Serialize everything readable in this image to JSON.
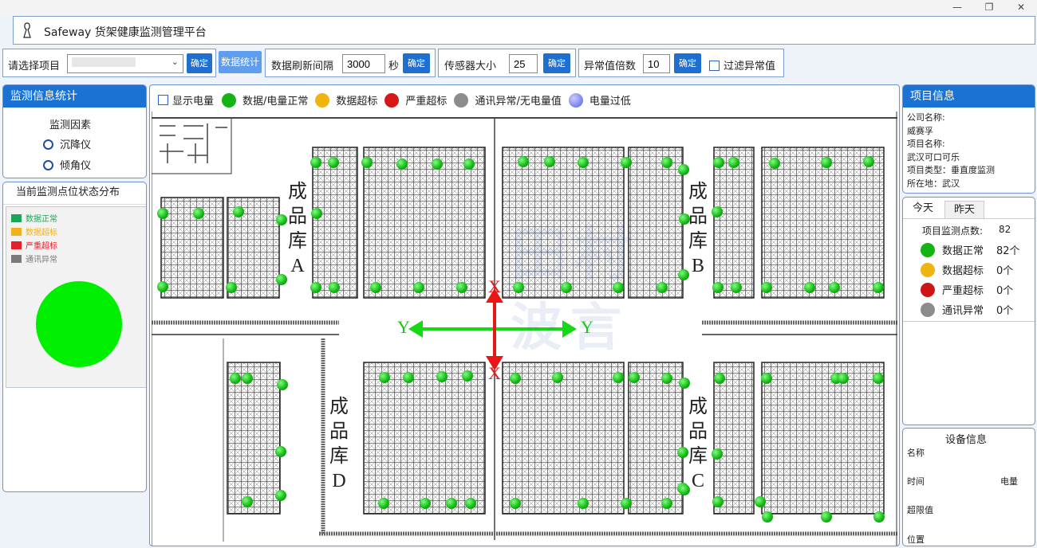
{
  "window": {
    "minimize": "—",
    "maximize": "❐",
    "close": "✕"
  },
  "app": {
    "title": "Safeway 货架健康监测管理平台"
  },
  "toolbar": {
    "project_label": "请选择项目",
    "project_value": "",
    "confirm1": "确定",
    "stats_button": "数据统计",
    "refresh_label": "数据刷新间隔",
    "refresh_value": "3000",
    "refresh_unit": "秒",
    "confirm2": "确定",
    "sensor_size_label": "传感器大小",
    "sensor_size_value": "25",
    "confirm3": "确定",
    "anomaly_label": "异常值倍数",
    "anomaly_value": "10",
    "confirm4": "确定",
    "filter_label": "过滤异常值"
  },
  "left": {
    "monitor_title": "监测信息统计",
    "factor_title": "监测因素",
    "factors": [
      "沉降仪",
      "倾角仪"
    ],
    "dist_title": "当前监测点位状态分布",
    "legend": [
      {
        "label": "数据正常",
        "color": "#1aa656"
      },
      {
        "label": "数据超标",
        "color": "#f2b11c"
      },
      {
        "label": "严重超标",
        "color": "#e5202a"
      },
      {
        "label": "通讯异常",
        "color": "#7a7a7a"
      }
    ],
    "pie_color": "#00ee00"
  },
  "map_legend": {
    "show_battery": "显示电量",
    "items": [
      {
        "label": "数据/电量正常",
        "color": "#14b414"
      },
      {
        "label": "数据超标",
        "color": "#f0b412"
      },
      {
        "label": "严重超标",
        "color": "#d41818"
      },
      {
        "label": "通讯异常/无电量值",
        "color": "#8c8c8c"
      },
      {
        "label": "电量过低",
        "color": "#6e78e6"
      }
    ]
  },
  "map": {
    "warehouses": [
      {
        "chars": [
          "成",
          "品",
          "库",
          "A"
        ]
      },
      {
        "chars": [
          "成",
          "品",
          "库",
          "B"
        ]
      },
      {
        "chars": [
          "成",
          "品",
          "库",
          "C"
        ]
      },
      {
        "chars": [
          "成",
          "品",
          "库",
          "D"
        ]
      }
    ],
    "axes": {
      "x": "X",
      "y": "Y"
    },
    "watermark": [
      "田",
      "村",
      "波",
      "言"
    ]
  },
  "project": {
    "title": "项目信息",
    "lines": [
      "公司名称:",
      "威赛孚",
      "项目名称:",
      "武汉可口可乐",
      "项目类型：垂直度监测",
      "所在地：武汉"
    ]
  },
  "stats": {
    "tabs": [
      "今天",
      "昨天"
    ],
    "total_label": "项目监测点数:",
    "total_value": "82",
    "rows": [
      {
        "label": "数据正常",
        "value": "82个",
        "color": "#14b414"
      },
      {
        "label": "数据超标",
        "value": "0个",
        "color": "#f0b412"
      },
      {
        "label": "严重超标",
        "value": "0个",
        "color": "#cc1515"
      },
      {
        "label": "通讯异常",
        "value": "0个",
        "color": "#8c8c8c"
      }
    ]
  },
  "device": {
    "title": "设备信息",
    "name_label": "名称",
    "time_label": "时间",
    "battery_label": "电量",
    "limit_label": "超限值",
    "position_label": "位置"
  }
}
